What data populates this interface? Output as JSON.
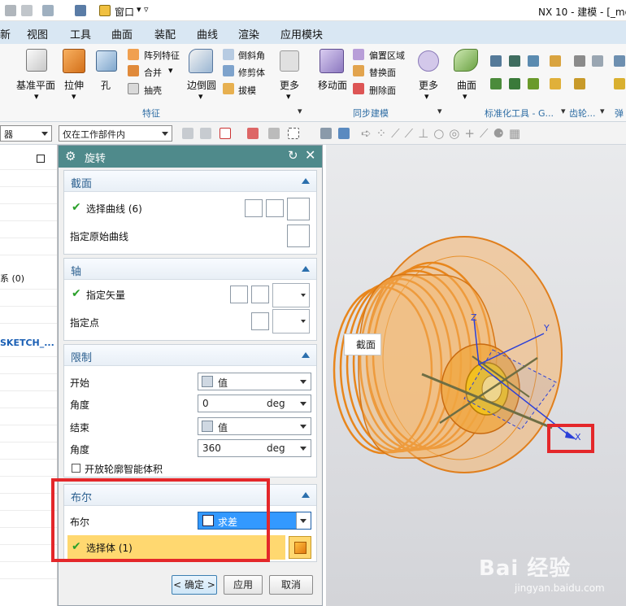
{
  "titlebar": {
    "window_menu": "窗口",
    "title": "NX 10 - 建模 - [_mo"
  },
  "menu": [
    "新",
    "视图",
    "工具",
    "曲面",
    "装配",
    "曲线",
    "渲染",
    "应用模块"
  ],
  "ribbon": {
    "big_buttons": [
      "基准平面",
      "拉伸",
      "孔",
      "边倒圆",
      "更多",
      "移动面",
      "更多",
      "曲面"
    ],
    "feature_small": [
      "阵列特征",
      "合并",
      "抽壳"
    ],
    "round_small": [
      "倒斜角",
      "修剪体",
      "拔模"
    ],
    "sync_small": [
      "偏置区域",
      "替换面",
      "删除面"
    ],
    "groups": [
      "特征",
      "同步建模",
      "标准化工具 - G...",
      "齿轮...",
      "弹"
    ]
  },
  "toolbar2": {
    "filter_left": "器",
    "filter_scope": "仅在工作部件内"
  },
  "nav": {
    "item_sys": "系 (0)",
    "item_sketch": "SKETCH_..."
  },
  "dialog": {
    "title": "旋转",
    "sections": {
      "section": {
        "header": "截面",
        "select_curve": "选择曲线 (6)",
        "original_curve": "指定原始曲线"
      },
      "axis": {
        "header": "轴",
        "vector": "指定矢量",
        "point": "指定点"
      },
      "limits": {
        "header": "限制",
        "start": "开始",
        "start_mode": "值",
        "angle1_label": "角度",
        "angle1_value": "0",
        "unit": "deg",
        "end": "结束",
        "end_mode": "值",
        "angle2_label": "角度",
        "angle2_value": "360",
        "open_profile": "开放轮廓智能体积"
      },
      "boolean": {
        "header": "布尔",
        "bool_label": "布尔",
        "bool_value": "求差",
        "select_body": "选择体 (1)"
      }
    },
    "buttons": {
      "ok": "< 确定 >",
      "apply": "应用",
      "cancel": "取消"
    }
  },
  "viewport": {
    "tag": "截面",
    "axis_x": "X",
    "axis_y": "Y",
    "axis_z": "Z"
  },
  "watermark": {
    "brand": "Bai 经验",
    "url": "jingyan.baidu.com"
  },
  "colors": {
    "accent_header": "#4f8a8b",
    "highlight": "#ffd870",
    "selected": "#3399ff",
    "part": "#f39c3d",
    "red_box": "#e4272a"
  }
}
